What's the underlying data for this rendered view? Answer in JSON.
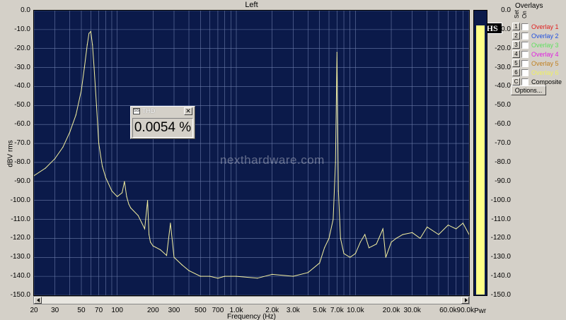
{
  "window": {
    "title": "Left"
  },
  "chart_data": {
    "type": "line",
    "xlabel": "Frequency (Hz)",
    "ylabel": "dBV rms",
    "xscale": "log",
    "xlim": [
      20,
      90000
    ],
    "ylim": [
      -150,
      0
    ],
    "grid": true,
    "x_ticks": [
      "20",
      "30",
      "50",
      "70",
      "100",
      "200",
      "300",
      "500",
      "700",
      "1.0k",
      "2.0k",
      "3.0k",
      "5.0k",
      "7.0k",
      "10.0k",
      "20.0k",
      "30.0k",
      "60.0k",
      "90.0k"
    ],
    "x_tick_values": [
      20,
      30,
      50,
      70,
      100,
      200,
      300,
      500,
      700,
      1000,
      2000,
      3000,
      5000,
      7000,
      10000,
      20000,
      30000,
      60000,
      90000
    ],
    "y_ticks": [
      "0.0",
      "-10.0",
      "-20.0",
      "-30.0",
      "-40.0",
      "-50.0",
      "-60.0",
      "-70.0",
      "-80.0",
      "-90.0",
      "-100.0",
      "-110.0",
      "-120.0",
      "-130.0",
      "-140.0",
      "-150.0"
    ],
    "series": [
      {
        "color": "#f4f0a0",
        "x": [
          20,
          25,
          30,
          35,
          40,
          45,
          50,
          53,
          56,
          58,
          60,
          62,
          64,
          67,
          70,
          75,
          80,
          90,
          100,
          110,
          115,
          120,
          125,
          130,
          150,
          170,
          180,
          185,
          190,
          200,
          230,
          260,
          280,
          300,
          350,
          400,
          500,
          600,
          700,
          800,
          1000,
          1500,
          2000,
          3000,
          4000,
          5000,
          5500,
          6000,
          6500,
          6800,
          7000,
          7200,
          7500,
          8000,
          9000,
          10000,
          11000,
          12000,
          13000,
          15000,
          17000,
          18000,
          20000,
          22000,
          25000,
          30000,
          35000,
          40000,
          50000,
          60000,
          70000,
          80000,
          90000
        ],
        "y": [
          -87,
          -83,
          -78,
          -72,
          -64,
          -55,
          -42,
          -30,
          -18,
          -12,
          -11,
          -18,
          -30,
          -50,
          -70,
          -82,
          -88,
          -95,
          -98,
          -96,
          -90,
          -98,
          -102,
          -104,
          -108,
          -115,
          -100,
          -118,
          -122,
          -124,
          -126,
          -129,
          -112,
          -130,
          -134,
          -137,
          -140,
          -140,
          -141,
          -140,
          -140,
          -141,
          -139,
          -140,
          -138,
          -133,
          -125,
          -120,
          -110,
          -80,
          -22,
          -95,
          -120,
          -128,
          -130,
          -128,
          -122,
          -118,
          -125,
          -123,
          -115,
          -130,
          -122,
          -120,
          -118,
          -117,
          -120,
          -114,
          -118,
          -113,
          -115,
          -112,
          -118
        ]
      }
    ]
  },
  "thd_window": {
    "title": "THD",
    "value": "0.0054 %"
  },
  "phs_badge": "PHS",
  "power_meter": {
    "label": "Pwr",
    "level_db": -8,
    "y_ticks": [
      "0.0",
      "-10.0",
      "-20.0",
      "-30.0",
      "-40.0",
      "-50.0",
      "-60.0",
      "-70.0",
      "-80.0",
      "-90.0",
      "-100.0",
      "-110.0",
      "-120.0",
      "-130.0",
      "-140.0",
      "-150.0"
    ]
  },
  "overlays": {
    "title": "Overlays",
    "col_set": "Set",
    "col_on": "On",
    "rows": [
      {
        "num": "1",
        "label": "Overlay 1",
        "color": "#e02020"
      },
      {
        "num": "2",
        "label": "Overlay 2",
        "color": "#2050e0"
      },
      {
        "num": "3",
        "label": "Overlay 3",
        "color": "#60e060"
      },
      {
        "num": "4",
        "label": "Overlay 4",
        "color": "#e020e0"
      },
      {
        "num": "5",
        "label": "Overlay 5",
        "color": "#c08020"
      },
      {
        "num": "6",
        "label": "Overlay 6",
        "color": "#f0f060"
      },
      {
        "num": "C",
        "label": "Composite",
        "color": "#000000"
      }
    ],
    "options_label": "Options..."
  },
  "watermark": "nexthardware.com",
  "colors": {
    "plot_bg": "#0b1a4a",
    "grid": "#6a7aa8",
    "trace": "#f4f0a0",
    "meter_fill": "#ffff88"
  }
}
